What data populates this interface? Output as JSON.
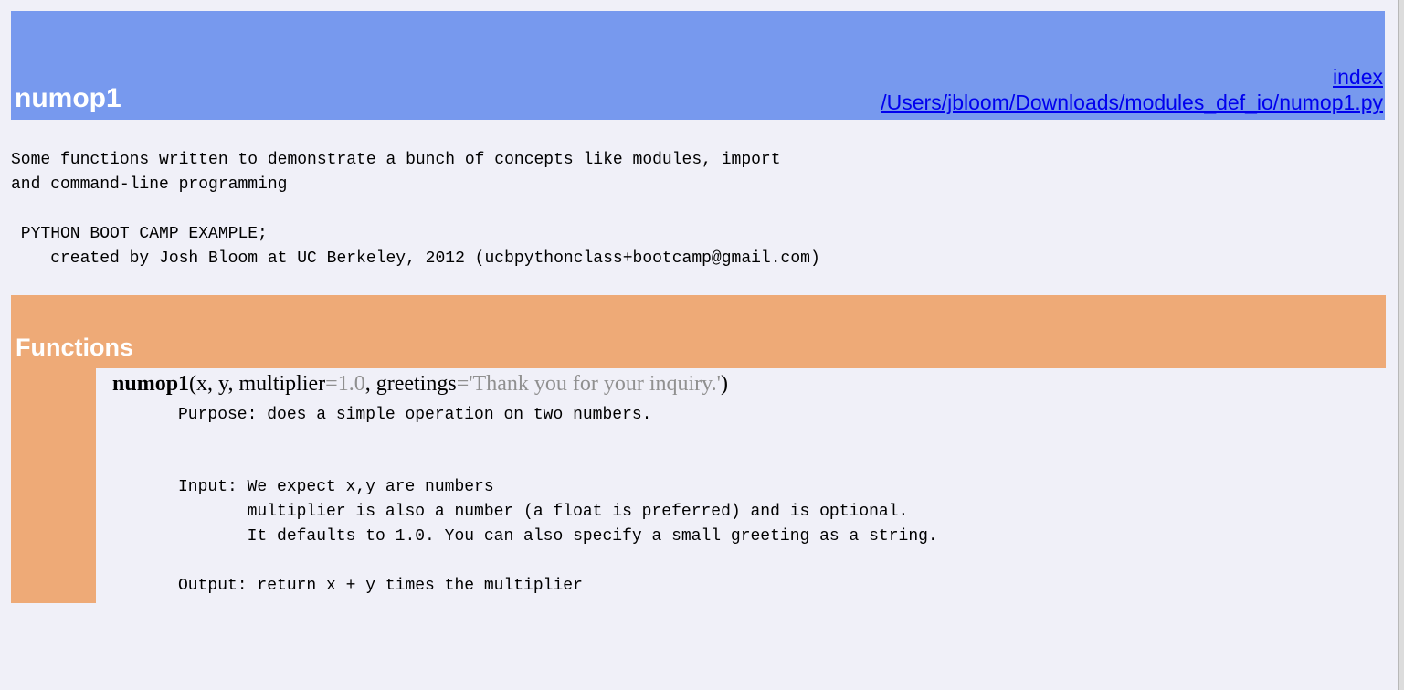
{
  "module": {
    "title": "numop1",
    "index_link": "index",
    "path_link": "/Users/jbloom/Downloads/modules_def_io/numop1.py",
    "header_color": "#7799ee"
  },
  "docstring": {
    "line1": "Some functions written to demonstrate a bunch of concepts like modules, import",
    "line2": "and command-line programming",
    "line3": " PYTHON BOOT CAMP EXAMPLE;",
    "line4": "    created by Josh Bloom at UC Berkeley, 2012 (ucbpythonclass+bootcamp@gmail.com)"
  },
  "functions": {
    "title": "Functions",
    "section_color": "#eeaa77",
    "items": [
      {
        "name": "numop1",
        "open_paren": "(",
        "param_x": "x",
        "sep1": ", ",
        "param_y": "y",
        "sep2": ", ",
        "param_multiplier": "multiplier",
        "default_multiplier": "=1.0",
        "sep3": ", ",
        "param_greetings": "greetings",
        "default_greetings": "='Thank you for your inquiry.'",
        "close_paren": ")",
        "doc": {
          "purpose": "Purpose: does a simple operation on two numbers.",
          "input_line1": "Input: We expect x,y are numbers",
          "input_line2": "       multiplier is also a number (a float is preferred) and is optional.",
          "input_line3": "       It defaults to 1.0. You can also specify a small greeting as a string.",
          "output": "Output: return x + y times the multiplier"
        }
      }
    ]
  }
}
